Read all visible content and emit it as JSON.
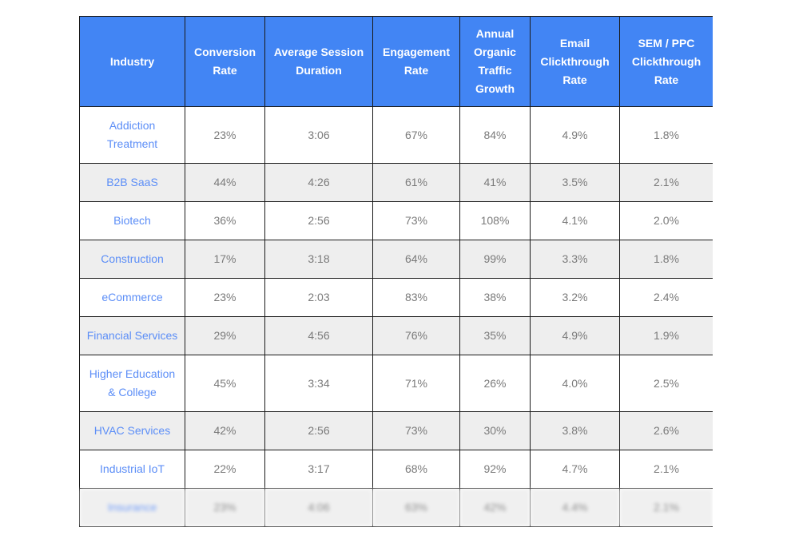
{
  "table": {
    "columns": [
      "Industry",
      "Conversion Rate",
      "Average Session Duration",
      "Engagement Rate",
      "Annual Organic Traffic Growth",
      "Email Clickthrough Rate",
      "SEM / PPC Clickthrough Rate"
    ],
    "header_bg": "#4285f4",
    "header_text_color": "#ffffff",
    "link_color": "#5c8ef7",
    "cell_text_color": "#7a7a7a",
    "alt_row_bg": "#eeeeee",
    "border_color": "#1a1a1a",
    "rows": [
      {
        "industry": "Addiction Treatment",
        "conversion_rate": "23%",
        "avg_session_duration": "3:06",
        "engagement_rate": "67%",
        "annual_organic_traffic_growth": "84%",
        "email_ctr": "4.9%",
        "sem_ppc_ctr": "1.8%"
      },
      {
        "industry": "B2B SaaS",
        "conversion_rate": "44%",
        "avg_session_duration": "4:26",
        "engagement_rate": "61%",
        "annual_organic_traffic_growth": "41%",
        "email_ctr": "3.5%",
        "sem_ppc_ctr": "2.1%"
      },
      {
        "industry": "Biotech",
        "conversion_rate": "36%",
        "avg_session_duration": "2:56",
        "engagement_rate": "73%",
        "annual_organic_traffic_growth": "108%",
        "email_ctr": "4.1%",
        "sem_ppc_ctr": "2.0%"
      },
      {
        "industry": "Construction",
        "conversion_rate": "17%",
        "avg_session_duration": "3:18",
        "engagement_rate": "64%",
        "annual_organic_traffic_growth": "99%",
        "email_ctr": "3.3%",
        "sem_ppc_ctr": "1.8%"
      },
      {
        "industry": "eCommerce",
        "conversion_rate": "23%",
        "avg_session_duration": "2:03",
        "engagement_rate": "83%",
        "annual_organic_traffic_growth": "38%",
        "email_ctr": "3.2%",
        "sem_ppc_ctr": "2.4%"
      },
      {
        "industry": "Financial Services",
        "conversion_rate": "29%",
        "avg_session_duration": "4:56",
        "engagement_rate": "76%",
        "annual_organic_traffic_growth": "35%",
        "email_ctr": "4.9%",
        "sem_ppc_ctr": "1.9%"
      },
      {
        "industry": "Higher Education & College",
        "conversion_rate": "45%",
        "avg_session_duration": "3:34",
        "engagement_rate": "71%",
        "annual_organic_traffic_growth": "26%",
        "email_ctr": "4.0%",
        "sem_ppc_ctr": "2.5%"
      },
      {
        "industry": "HVAC Services",
        "conversion_rate": "42%",
        "avg_session_duration": "2:56",
        "engagement_rate": "73%",
        "annual_organic_traffic_growth": "30%",
        "email_ctr": "3.8%",
        "sem_ppc_ctr": "2.6%"
      },
      {
        "industry": "Industrial IoT",
        "conversion_rate": "22%",
        "avg_session_duration": "3:17",
        "engagement_rate": "68%",
        "annual_organic_traffic_growth": "92%",
        "email_ctr": "4.7%",
        "sem_ppc_ctr": "2.1%"
      },
      {
        "industry": "Insurance",
        "conversion_rate": "23%",
        "avg_session_duration": "4:06",
        "engagement_rate": "63%",
        "annual_organic_traffic_growth": "42%",
        "email_ctr": "4.4%",
        "sem_ppc_ctr": "2.1%"
      }
    ]
  }
}
